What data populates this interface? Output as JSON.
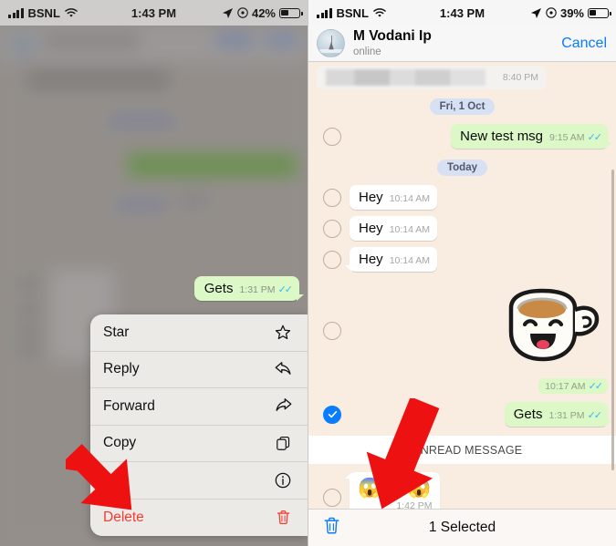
{
  "left": {
    "status": {
      "carrier": "BSNL",
      "wifi_icon": "wifi-icon",
      "time": "1:43 PM",
      "location_icon": "location-arrow-icon",
      "alarm_icon": "clock-icon",
      "battery": "42%"
    },
    "selected_message": {
      "text": "Gets",
      "time": "1:31 PM",
      "ticks": "read-receipt-double-check"
    },
    "context_menu": [
      {
        "label": "Star",
        "icon": "star-icon"
      },
      {
        "label": "Reply",
        "icon": "reply-arrow-icon"
      },
      {
        "label": "Forward",
        "icon": "forward-arrow-icon"
      },
      {
        "label": "Copy",
        "icon": "copy-icon"
      },
      {
        "label": "Info",
        "icon": "info-circle-icon"
      },
      {
        "label": "Delete",
        "icon": "trash-icon"
      }
    ],
    "annotation_arrow": "red-arrow-pointing-to-delete"
  },
  "right": {
    "status": {
      "carrier": "BSNL",
      "wifi_icon": "wifi-icon",
      "time": "1:43 PM",
      "location_icon": "location-arrow-icon",
      "alarm_icon": "clock-icon",
      "battery": "39%"
    },
    "header": {
      "name": "M Vodani Ip",
      "presence": "online",
      "cancel_label": "Cancel",
      "avatar": "contact-avatar"
    },
    "messages": [
      {
        "kind": "blurred",
        "direction": "in",
        "time": "8:40 PM",
        "selectable": false
      },
      {
        "kind": "date",
        "label": "Fri, 1 Oct"
      },
      {
        "kind": "text",
        "direction": "out",
        "text": "New test msg",
        "time": "9:15 AM",
        "ticks": "read-receipt-double-check",
        "selected": false
      },
      {
        "kind": "date",
        "label": "Today"
      },
      {
        "kind": "text",
        "direction": "in",
        "text": "Hey",
        "time": "10:14 AM",
        "selected": false
      },
      {
        "kind": "text",
        "direction": "in",
        "text": "Hey",
        "time": "10:14 AM",
        "selected": false
      },
      {
        "kind": "text",
        "direction": "in",
        "text": "Hey",
        "time": "10:14 AM",
        "selected": false
      },
      {
        "kind": "sticker",
        "direction": "out",
        "sticker": "smiling-coffee-cup-sticker",
        "time": "10:17 AM",
        "ticks": "read-receipt-double-check",
        "selected": false
      },
      {
        "kind": "text",
        "direction": "out",
        "text": "Gets",
        "time": "1:31 PM",
        "ticks": "read-receipt-double-check",
        "selected": true
      },
      {
        "kind": "unread_divider",
        "label": "1 UNREAD MESSAGE"
      },
      {
        "kind": "emoji",
        "direction": "in",
        "emojis": "😱😱😱",
        "time": "1:42 PM",
        "selected": false
      }
    ],
    "bottom_bar": {
      "delete_icon": "trash-icon",
      "selection_label": "1 Selected"
    },
    "annotation_arrow": "red-arrow-pointing-to-trash"
  },
  "colors": {
    "outgoing_bubble": "#dcf8c6",
    "incoming_bubble": "#ffffff",
    "chat_background": "#f9ece0",
    "accent_blue": "#0a7cff",
    "tick_blue": "#34b7f1",
    "danger_red": "#f53b30",
    "date_pill": "#d7e1f3",
    "annotation_red": "#ee1111"
  }
}
